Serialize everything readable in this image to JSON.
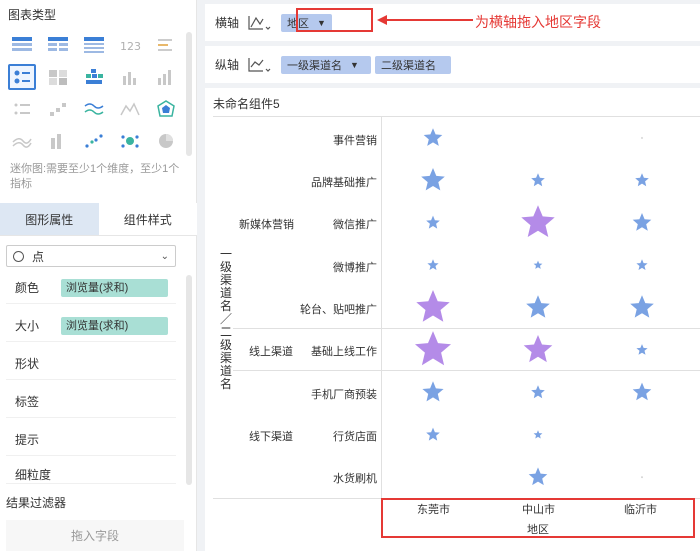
{
  "left_panel": {
    "chart_types_title": "图表类型",
    "hint": "迷你图:需要至少1个维度，至少1个指标",
    "tabs": {
      "graph_props": "图形属性",
      "component_style": "组件样式"
    },
    "mark_type": "点",
    "props": [
      {
        "label": "颜色",
        "field": "浏览量(求和)"
      },
      {
        "label": "大小",
        "field": "浏览量(求和)"
      },
      {
        "label": "形状",
        "field": ""
      },
      {
        "label": "标签",
        "field": ""
      },
      {
        "label": "提示",
        "field": ""
      },
      {
        "label": "细粒度",
        "field": ""
      }
    ],
    "filter_title": "结果过滤器",
    "drop_placeholder": "拖入字段"
  },
  "axes": {
    "x_label": "横轴",
    "y_label": "纵轴",
    "x_fields": [
      "地区"
    ],
    "y_fields": [
      "一级渠道名",
      "二级渠道名"
    ],
    "annotation": "为横轴拖入地区字段"
  },
  "colors": {
    "accent": "#3b7fd6",
    "annotation": "#e53935",
    "pill_blue": "#b5c9ee",
    "pill_green": "#a9dfd5",
    "star_blue": "#7aa2e3",
    "star_purple": "#b48be8"
  },
  "chart_data": {
    "type": "scatter",
    "component_name": "未命名组件5",
    "x_title": "地区",
    "y_title": "一级渠道名／二级渠道名",
    "x_categories": [
      "东莞市",
      "中山市",
      "临沂市"
    ],
    "groups": [
      {
        "name": "新媒体营销",
        "rows": [
          "事件营销",
          "品牌基础推广",
          "微信推广",
          "微博推广",
          "轮台、贴吧推广"
        ]
      },
      {
        "name": "线上渠道",
        "rows": [
          "基础上线工作"
        ]
      },
      {
        "name": "线下渠道",
        "rows": [
          "手机厂商预装",
          "行货店面",
          "水货刷机"
        ]
      }
    ],
    "points": [
      {
        "row": "事件营销",
        "x": "东莞市",
        "size": 3,
        "color": "blue"
      },
      {
        "row": "事件营销",
        "x": "临沂市",
        "size": 0.5,
        "color": "gray"
      },
      {
        "row": "品牌基础推广",
        "x": "东莞市",
        "size": 4,
        "color": "blue"
      },
      {
        "row": "品牌基础推广",
        "x": "中山市",
        "size": 2,
        "color": "blue"
      },
      {
        "row": "品牌基础推广",
        "x": "临沂市",
        "size": 2,
        "color": "blue"
      },
      {
        "row": "微信推广",
        "x": "东莞市",
        "size": 2,
        "color": "blue"
      },
      {
        "row": "微信推广",
        "x": "中山市",
        "size": 6,
        "color": "purple"
      },
      {
        "row": "微信推广",
        "x": "临沂市",
        "size": 3,
        "color": "blue"
      },
      {
        "row": "微博推广",
        "x": "东莞市",
        "size": 1.5,
        "color": "blue"
      },
      {
        "row": "微博推广",
        "x": "中山市",
        "size": 1,
        "color": "blue"
      },
      {
        "row": "微博推广",
        "x": "临沂市",
        "size": 1.5,
        "color": "blue"
      },
      {
        "row": "轮台、贴吧推广",
        "x": "东莞市",
        "size": 6,
        "color": "purple"
      },
      {
        "row": "轮台、贴吧推广",
        "x": "中山市",
        "size": 4,
        "color": "blue"
      },
      {
        "row": "轮台、贴吧推广",
        "x": "临沂市",
        "size": 4,
        "color": "blue"
      },
      {
        "row": "基础上线工作",
        "x": "东莞市",
        "size": 6.5,
        "color": "purple"
      },
      {
        "row": "基础上线工作",
        "x": "中山市",
        "size": 5,
        "color": "purple"
      },
      {
        "row": "基础上线工作",
        "x": "临沂市",
        "size": 1.5,
        "color": "blue"
      },
      {
        "row": "手机厂商预装",
        "x": "东莞市",
        "size": 3.5,
        "color": "blue"
      },
      {
        "row": "手机厂商预装",
        "x": "中山市",
        "size": 2,
        "color": "blue"
      },
      {
        "row": "手机厂商预装",
        "x": "临沂市",
        "size": 3,
        "color": "blue"
      },
      {
        "row": "行货店面",
        "x": "东莞市",
        "size": 2,
        "color": "blue"
      },
      {
        "row": "行货店面",
        "x": "中山市",
        "size": 1,
        "color": "blue"
      },
      {
        "row": "水货刷机",
        "x": "中山市",
        "size": 3,
        "color": "blue"
      },
      {
        "row": "水货刷机",
        "x": "临沂市",
        "size": 0.5,
        "color": "gray"
      }
    ]
  }
}
